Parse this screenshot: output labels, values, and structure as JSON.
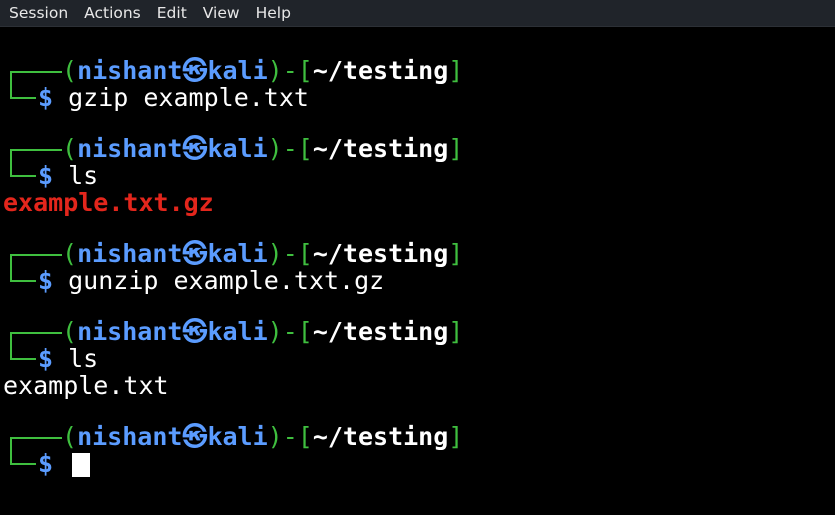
{
  "menu": [
    "Session",
    "Actions",
    "Edit",
    "View",
    "Help"
  ],
  "prompt": {
    "open": "(",
    "user": "nishant",
    "at_icon": "㉿",
    "host": "kali",
    "mid": ")-[",
    "path": "~/testing",
    "close": "]",
    "symbol": "$"
  },
  "blocks": [
    {
      "command": "gzip example.txt",
      "output": ""
    },
    {
      "command": "ls",
      "output": "example.txt.gz"
    },
    {
      "command": "gunzip example.txt.gz",
      "output": ""
    },
    {
      "command": "ls",
      "output": "example.txt"
    },
    {
      "command": "",
      "output": ""
    }
  ],
  "colors": {
    "green": "#3fbf3f",
    "blue": "#5b9cff",
    "red": "#e3261c",
    "background": "#000000"
  }
}
